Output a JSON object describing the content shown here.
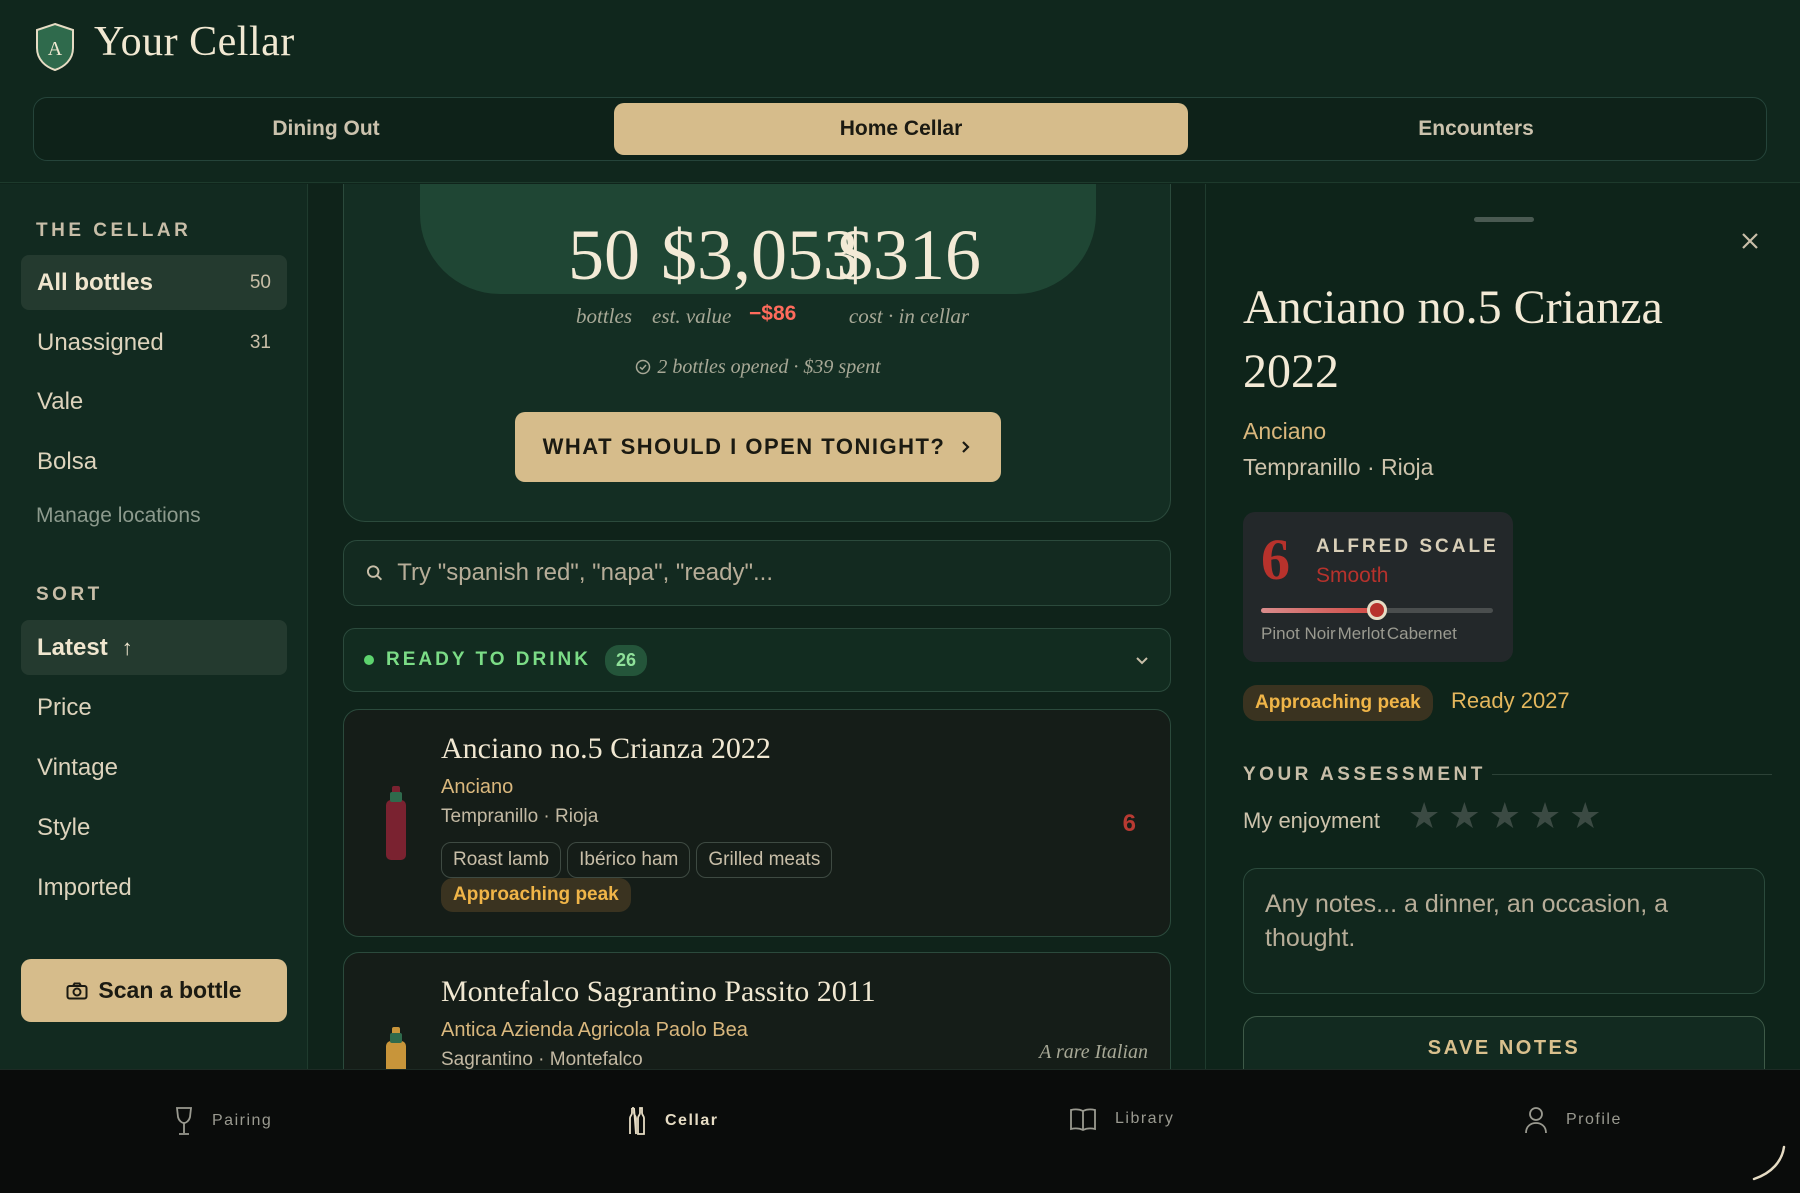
{
  "app": {
    "title": "Your Cellar",
    "logo_letter": "A"
  },
  "mode_tabs": [
    {
      "label": "Dining Out",
      "active": false
    },
    {
      "label": "Home Cellar",
      "active": true
    },
    {
      "label": "Encounters",
      "active": false
    }
  ],
  "sidebar": {
    "cellar_heading": "THE CELLAR",
    "locations": [
      {
        "label": "All bottles",
        "count": "50",
        "active": true
      },
      {
        "label": "Unassigned",
        "count": "31",
        "active": false
      },
      {
        "label": "Vale",
        "count": "",
        "active": false
      },
      {
        "label": "Bolsa",
        "count": "",
        "active": false
      }
    ],
    "manage_label": "Manage locations",
    "sort_heading": "SORT",
    "sort_options": [
      {
        "label": "Latest",
        "active": true,
        "arrow": "↑"
      },
      {
        "label": "Price",
        "active": false
      },
      {
        "label": "Vintage",
        "active": false
      },
      {
        "label": "Style",
        "active": false
      },
      {
        "label": "Imported",
        "active": false
      }
    ],
    "scan_label": "Scan a bottle"
  },
  "stats": {
    "bottles": {
      "value": "50",
      "label": "bottles"
    },
    "value": {
      "value": "$3,053",
      "label": "est. value",
      "delta": "−$86"
    },
    "cost": {
      "value": "$316",
      "label": "cost · in cellar"
    },
    "opened_line": "2 bottles opened · $39 spent",
    "cta_label": "WHAT SHOULD I OPEN TONIGHT?"
  },
  "search": {
    "placeholder": "Try \"spanish red\", \"napa\", \"ready\"..."
  },
  "ready_section": {
    "label": "READY TO DRINK",
    "count": "26"
  },
  "wines": [
    {
      "title": "Anciano no.5 Crianza 2022",
      "producer": "Anciano",
      "variety": "Tempranillo · Rioja",
      "pairings": [
        "Roast lamb",
        "Ibérico ham",
        "Grilled meats"
      ],
      "status": "Approaching peak",
      "score": "6",
      "bottle_color": "#7a2230"
    },
    {
      "title": "Montefalco Sagrantino Passito 2011",
      "producer": "Antica Azienda Agricola Paolo Bea",
      "variety": "Sagrantino · Montefalco",
      "note": "A rare Italian",
      "bottle_color": "#c8953a"
    }
  ],
  "detail": {
    "title": "Anciano no.5 Crianza 2022",
    "producer": "Anciano",
    "variety": "Tempranillo · Rioja",
    "scale": {
      "number": "6",
      "title": "ALFRED SCALE",
      "word": "Smooth",
      "position": 0.5,
      "ticks": [
        "Pinot Noir",
        "Merlot",
        "Cabernet"
      ]
    },
    "status": "Approaching peak",
    "ready": "Ready 2027",
    "assessment_heading": "YOUR ASSESSMENT",
    "enjoyment_label": "My enjoyment",
    "rating": 0,
    "notes_placeholder": "Any notes... a dinner, an occasion, a thought.",
    "save_label": "SAVE NOTES"
  },
  "bottom_nav": [
    {
      "label": "Pairing",
      "icon": "wine-glass-icon",
      "active": false
    },
    {
      "label": "Cellar",
      "icon": "bottles-icon",
      "active": true
    },
    {
      "label": "Library",
      "icon": "book-icon",
      "active": false
    },
    {
      "label": "Profile",
      "icon": "person-icon",
      "active": false
    }
  ],
  "colors": {
    "background": "#0f241b",
    "accent_gold": "#d6bc8b",
    "ready_green": "#7bdc86",
    "peak_amber": "#f0b548",
    "score_red": "#b7322c",
    "delta_red": "#ff6b5c"
  }
}
